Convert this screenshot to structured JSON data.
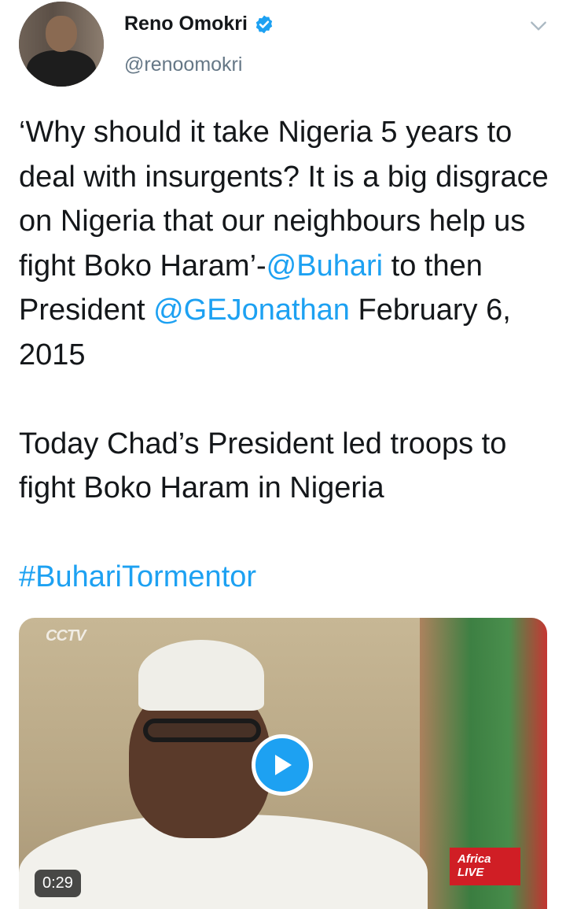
{
  "author": {
    "name": "Reno Omokri",
    "handle": "@renoomokri",
    "verified": true,
    "avatar_icon": "profile-photo"
  },
  "tweet": {
    "segments": [
      {
        "type": "text",
        "value": "‘Why should it take Nigeria 5 years to deal with insurgents? It is a big disgrace on Nigeria that our neighbours help us fight Boko Haram’-"
      },
      {
        "type": "mention",
        "value": "@Buhari"
      },
      {
        "type": "text",
        "value": " to then President "
      },
      {
        "type": "mention",
        "value": "@GEJonathan"
      },
      {
        "type": "text",
        "value": " February 6, 2015\n\nToday Chad’s President led troops to fight Boko Haram in Nigeria\n\n"
      },
      {
        "type": "hashtag",
        "value": "#BuhariTormentor"
      }
    ]
  },
  "media": {
    "type": "video",
    "duration": "0:29",
    "watermark": "CCTV",
    "overlay_badge": "Africa LIVE",
    "play_icon": "play-icon"
  },
  "colors": {
    "accent": "#1da1f2",
    "text": "#14171a",
    "secondary": "#657786"
  }
}
